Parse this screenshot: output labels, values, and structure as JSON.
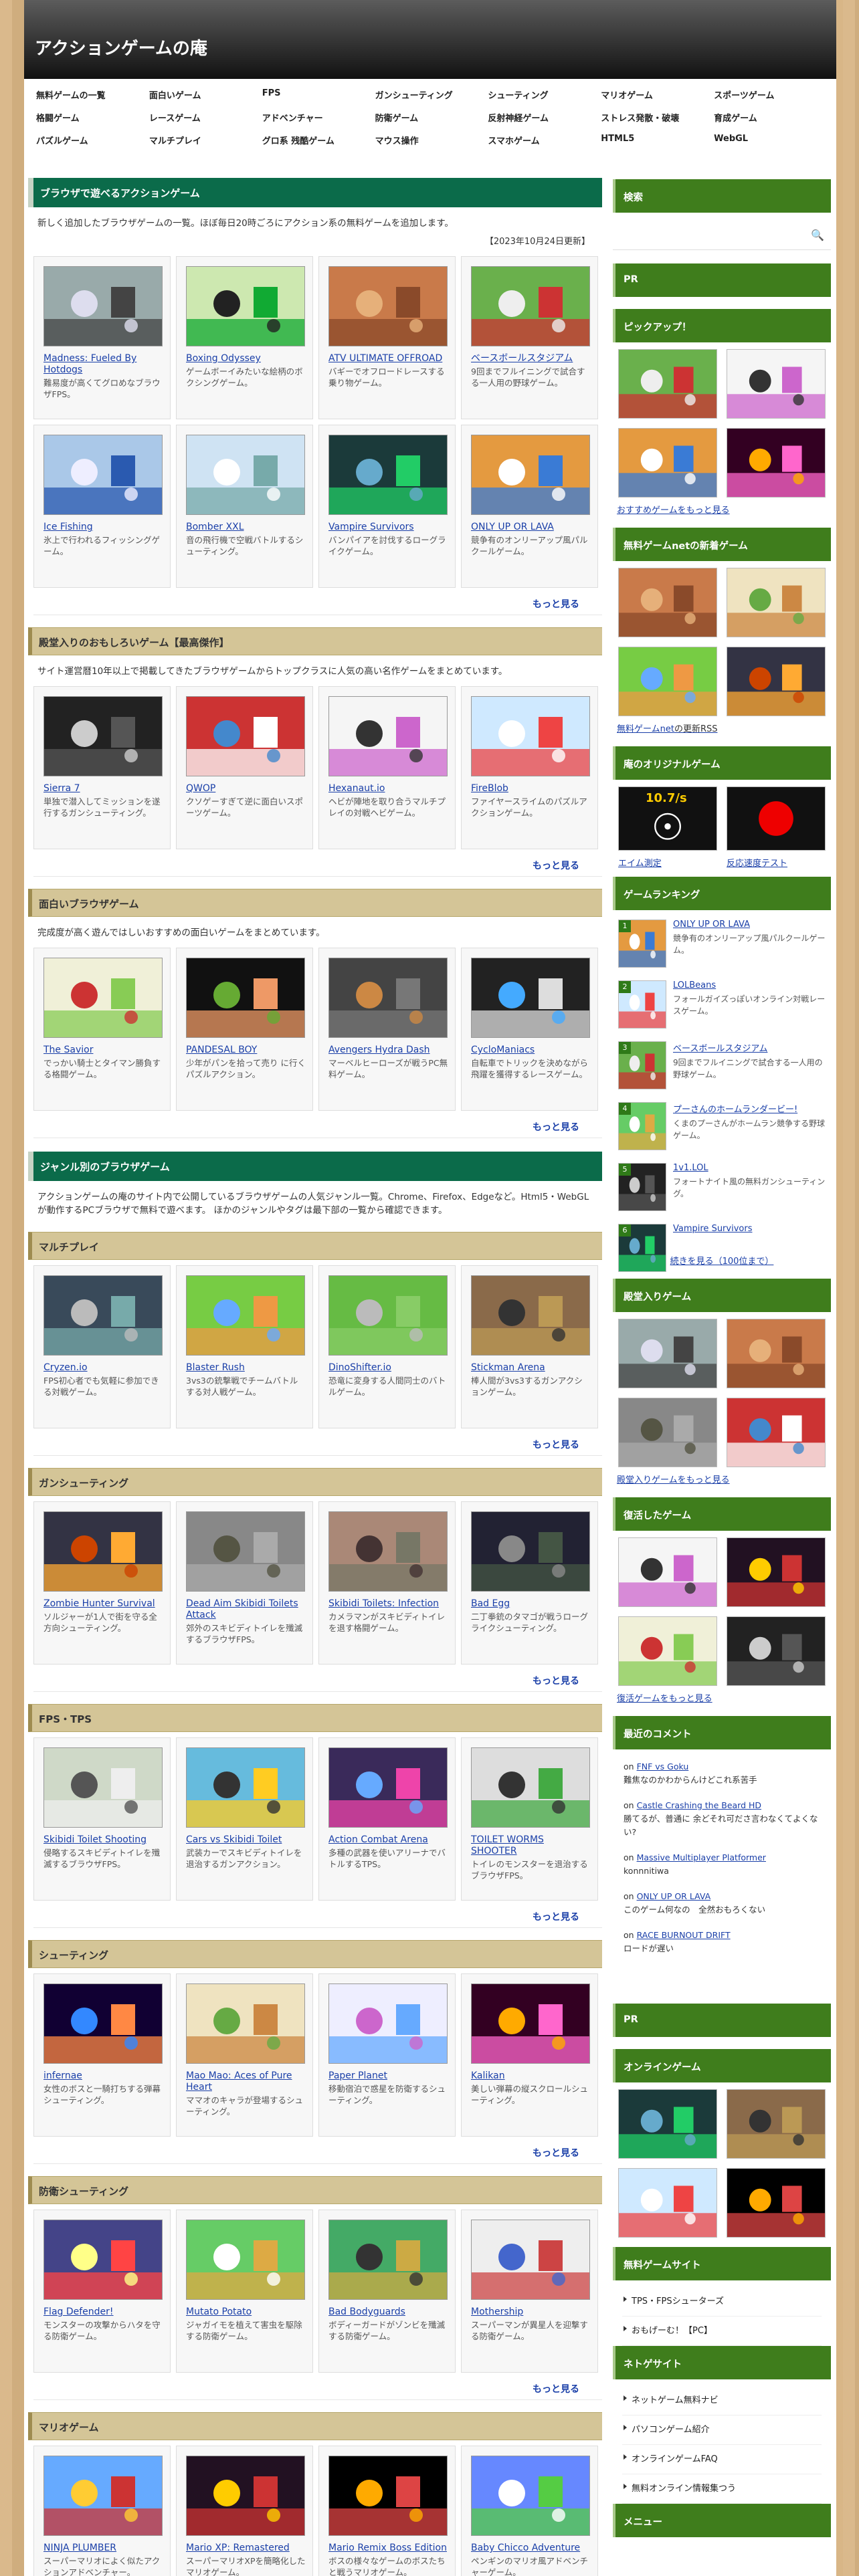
{
  "site": {
    "title": "アクションゲームの庵"
  },
  "nav": [
    "無料ゲームの一覧",
    "面白いゲーム",
    "FPS",
    "ガンシューティング",
    "シューティング",
    "マリオゲーム",
    "スポーツゲーム",
    "格闘ゲーム",
    "レースゲーム",
    "アドベンチャー",
    "防衛ゲーム",
    "反射神経ゲーム",
    "ストレス発散・破壊",
    "育成ゲーム",
    "パズルゲーム",
    "マルチプレイ",
    "グロ系 残酷ゲーム",
    "マウス操作",
    "スマホゲーム",
    "HTML5",
    "WebGL"
  ],
  "browser": {
    "heading": "ブラウザで遊べるアクションゲーム",
    "desc": "新しく追加したブラウザゲームの一覧。ほぼ毎日20時ごろにアクション系の無料ゲームを追加します。",
    "date": "【2023年10月24日更新】",
    "more": "もっと見る",
    "games": [
      {
        "title": "Madness: Fueled By Hotdogs",
        "desc": "難易度が高くてグロめなブラウザFPS。",
        "theme": "gun"
      },
      {
        "title": "Boxing Odyssey",
        "desc": "ゲームボーイみたいな絵柄のボクシングゲーム。",
        "theme": "box"
      },
      {
        "title": "ATV ULTIMATE OFFROAD",
        "desc": "バギーでオフロードレースする乗り物ゲーム。",
        "theme": "atv"
      },
      {
        "title": "ベースボールスタジアム",
        "desc": "9回までフルイニングで試合する一人用の野球ゲーム。",
        "theme": "base"
      },
      {
        "title": "Ice Fishing",
        "desc": "氷上で行われるフィッシングゲーム。",
        "theme": "ice"
      },
      {
        "title": "Bomber XXL",
        "desc": "音の飛行機で空戦バトルするシューティング。",
        "theme": "bomb"
      },
      {
        "title": "Vampire Survivors",
        "desc": "バンパイアを討伐するローグライクゲーム。",
        "theme": "vamp"
      },
      {
        "title": "ONLY UP OR LAVA",
        "desc": "競争有のオンリーアップ風パルクールゲーム。",
        "theme": "lava"
      }
    ]
  },
  "best": {
    "heading": "殿堂入りのおもしろいゲーム【最高傑作】",
    "desc": "サイト運営暦10年以上で掲載してきたブラウザゲームからトップクラスに人気の高い名作ゲームをまとめています。",
    "more": "もっと見る",
    "games": [
      {
        "title": "Sierra 7",
        "desc": "単独で潜入してミッションを遂行するガンシューティング。",
        "theme": "sierra"
      },
      {
        "title": "QWOP",
        "desc": "クソゲーすぎて逆に面白いスポーツゲーム。",
        "theme": "qwop"
      },
      {
        "title": "Hexanaut.io",
        "desc": "ヘビが陣地を取り合うマルチプレイの対戦ヘビゲーム。",
        "theme": "hex"
      },
      {
        "title": "FireBlob",
        "desc": "ファイヤースライムのパズルアクションゲーム。",
        "theme": "blob"
      }
    ]
  },
  "fun": {
    "heading": "面白いブラウザゲーム",
    "desc": "完成度が高く遊んではしいおすすめの面白いゲームをまとめています。",
    "more": "もっと見る",
    "games": [
      {
        "title": "The Savior",
        "desc": "でっかい騎士とタイマン勝負する格闘ゲーム。",
        "theme": "savior"
      },
      {
        "title": "PANDESAL BOY",
        "desc": "少年がパンを拾って売り に行くパズルアクション。",
        "theme": "pan"
      },
      {
        "title": "Avengers Hydra Dash",
        "desc": "マーベルヒーローズが戦うPC無料ゲーム。",
        "theme": "aven"
      },
      {
        "title": "CycloManiacs",
        "desc": "自転車でトリックを決めながら飛躍を獲得するレースゲーム。",
        "theme": "cyclo"
      }
    ]
  },
  "genre": {
    "heading": "ジャンル別のブラウザゲーム",
    "desc": "アクションゲームの庵のサイト内で公開しているブラウザゲームの人気ジャンル一覧。Chrome、Firefox、Edgeなど。Html5・WebGLが動作するPCブラウザで無料で遊べます。 ほかのジャンルやタグは最下部の一覧から確認できます。"
  },
  "multi": {
    "heading": "マルチプレイ",
    "more": "もっと見る",
    "games": [
      {
        "title": "Cryzen.io",
        "desc": "FPS初心者でも気軽に参加できる対戦ゲーム。",
        "theme": "cry"
      },
      {
        "title": "Blaster Rush",
        "desc": "3vs3の銃撃戦でチームバトルする対人戦ゲーム。",
        "theme": "blast"
      },
      {
        "title": "DinoShifter.io",
        "desc": "恐竜に変身する人間同士のバトルゲーム。",
        "theme": "dino"
      },
      {
        "title": "Stickman Arena",
        "desc": "棒人間が3vs3するガンアクションゲーム。",
        "theme": "stick"
      }
    ]
  },
  "gun": {
    "heading": "ガンシューティング",
    "more": "もっと見る",
    "games": [
      {
        "title": "Zombie Hunter Survival",
        "desc": "ソルジャーが1人で街を守る全方向シューティング。",
        "theme": "zomb"
      },
      {
        "title": "Dead Aim Skibidi Toilets Attack",
        "desc": "郊外のスキビディトイレを殲滅するブラウザFPS。",
        "theme": "dead"
      },
      {
        "title": "Skibidi Toilets: Infection",
        "desc": "カメラマンがスキビディトイレを退す格闘ゲーム。",
        "theme": "infect"
      },
      {
        "title": "Bad Egg",
        "desc": "二丁拳銃のタマゴが戦うローグライクシューティング。",
        "theme": "egg"
      }
    ]
  },
  "fps": {
    "heading": "FPS・TPS",
    "more": "もっと見る",
    "games": [
      {
        "title": "Skibidi Toilet Shooting",
        "desc": "侵略するスキビディトイレを殲滅するブラウザFPS。",
        "theme": "skshoot"
      },
      {
        "title": "Cars vs Skibidi Toilet",
        "desc": "武装カーでスキビディトイレを退治するガンアクション。",
        "theme": "cars"
      },
      {
        "title": "Action Combat Arena",
        "desc": "多種の武器を使いアリーナでバトルするTPS。",
        "theme": "arena"
      },
      {
        "title": "TOILET WORMS SHOOTER",
        "desc": "トイレのモンスターを退治するブラウザFPS。",
        "theme": "worm"
      }
    ]
  },
  "shoot": {
    "heading": "シューティング",
    "more": "もっと見る",
    "games": [
      {
        "title": "infernae",
        "desc": "女性のボスと一騎打ちする弾幕シューティング。",
        "theme": "inf"
      },
      {
        "title": "Mao Mao: Aces of Pure Heart",
        "desc": "ママオのキャラが登場するシューティング。",
        "theme": "mao"
      },
      {
        "title": "Paper Planet",
        "desc": "移動宿泊で惑星を防衛するシューティング。",
        "theme": "paper"
      },
      {
        "title": "Kalikan",
        "desc": "美しい弾幕の縦スクロールシューティング。",
        "theme": "kali"
      }
    ]
  },
  "defense": {
    "heading": "防衛シューティング",
    "more": "もっと見る",
    "games": [
      {
        "title": "Flag Defender!",
        "desc": "モンスターの攻撃からハタを守る防衛ゲーム。",
        "theme": "flag"
      },
      {
        "title": "Mutato Potato",
        "desc": "ジャガイモを植えて害虫を駆除する防衛ゲーム。",
        "theme": "potato"
      },
      {
        "title": "Bad Bodyguards",
        "desc": "ボディーガードがゾンビを殲滅する防衛ゲーム。",
        "theme": "body"
      },
      {
        "title": "Mothership",
        "desc": "スーパーマンが異星人を迎撃する防衛ゲーム。",
        "theme": "moth"
      }
    ]
  },
  "mario": {
    "heading": "マリオゲーム",
    "games": [
      {
        "title": "NINJA PLUMBER",
        "desc": "スーパーマリオによく似たアクションアドベンチャー。",
        "theme": "ninja"
      },
      {
        "title": "Mario XP: Remastered",
        "desc": "スーパーマリオXPを簡略化したマリオゲーム。",
        "theme": "mxp"
      },
      {
        "title": "Mario Remix Boss Edition",
        "desc": "ボスの様々なゲームのボスたちと戦うマリオゲーム。",
        "theme": "remix"
      },
      {
        "title": "Baby Chicco Adventure",
        "desc": "ペンギンのマリオ風アドベンチャーゲーム。",
        "theme": "chicco"
      }
    ]
  },
  "sidebar": {
    "search": "検索",
    "pr": "PR",
    "pickup": "ピックアップ！",
    "pickup_link": "おすすめゲームをもっと見る",
    "newgames": "無料ゲームnetの新着ゲーム",
    "newgames_link": "無料ゲームnet",
    "newgames_suffix": "の更新RSS",
    "original": "庵のオリジナルゲーム",
    "orig_items": [
      "エイム測定",
      "反応速度テスト"
    ],
    "orig_label": "10.7/s",
    "ranking": "ゲームランキング",
    "ranks": [
      {
        "no": "1",
        "title": "ONLY UP OR LAVA",
        "desc": "競争有のオンリーアップ風パルクールゲーム。"
      },
      {
        "no": "2",
        "title": "LOLBeans",
        "desc": "フォールガイズっぽいオンライン対戦レースゲーム。"
      },
      {
        "no": "3",
        "title": "ベースボールスタジアム",
        "desc": "9回までフルイニングで試合する一人用の野球ゲーム。"
      },
      {
        "no": "4",
        "title": "プーさんのホームランダービー!",
        "desc": "くまのプーさんがホームラン競争する野球ゲーム。"
      },
      {
        "no": "5",
        "title": "1v1.LOL",
        "desc": "フォートナイト風の無料ガンシューティング。"
      },
      {
        "no": "6",
        "title": "Vampire Survivors",
        "desc": ""
      }
    ],
    "rank_more": "続きを見る（100位まで）",
    "hall": "殿堂入りゲーム",
    "hall_link": "殿堂入りゲームをもっと見る",
    "revived": "復活したゲーム",
    "revived_link": "復活ゲームをもっと見る",
    "comments_head": "最近のコメント",
    "comments": [
      {
        "on": "on",
        "game": "FNF vs Goku",
        "text": "難焦なのかわからんけどこれ系苦手"
      },
      {
        "on": "on",
        "game": "Castle Crashing the Beard HD",
        "text": "勝てるが、普通に 余どそれ可ださ言わなくてよくない?"
      },
      {
        "on": "on",
        "game": "Massive Multiplayer Platformer",
        "text": "konnnitiwa"
      },
      {
        "on": "on",
        "game": "ONLY UP OR LAVA",
        "text": "このゲーム何なの　全然おもろくない"
      },
      {
        "on": "on",
        "game": "RACE BURNOUT DRIFT",
        "text": "ロードが遅い"
      }
    ],
    "pr2": "PR",
    "online": "オンラインゲーム",
    "freesite": "無料ゲームサイト",
    "freesite_items": [
      "TPS・FPSシューターズ",
      "おもげーむ！【PC】"
    ],
    "netsite": "ネトゲサイト",
    "netsite_items": [
      "ネットゲーム無料ナビ",
      "パソコンゲーム紹介",
      "オンラインゲームFAQ",
      "無料オンライン情報集つう"
    ],
    "menu": "メニュー"
  }
}
